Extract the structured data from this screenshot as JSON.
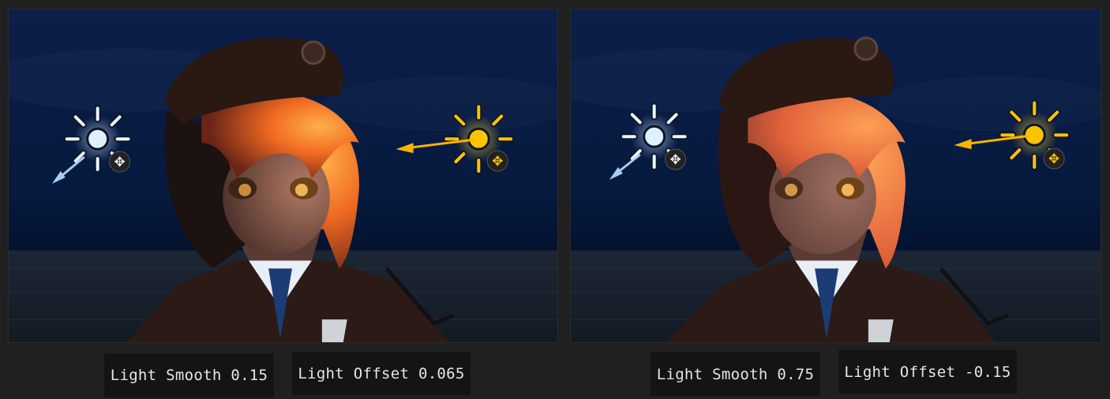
{
  "scenes": [
    {
      "light_smooth_text": "Light Smooth 0.15",
      "light_offset_text": "Light Offset 0.065",
      "light_smooth": 0.15,
      "light_offset": 0.065
    },
    {
      "light_smooth_text": "Light Smooth 0.75",
      "light_offset_text": "Light Offset -0.15",
      "light_smooth": 0.75,
      "light_offset": -0.15
    }
  ],
  "colors": {
    "background": "#202020",
    "caption_background": "#141414",
    "caption_text": "#e6e6e6",
    "sky": "#071a3e",
    "main_light": "#ffc400",
    "fill_light": "#dff0ff",
    "hair_lit": "#ff8a1a",
    "hair_shadow": "#7a2a1a"
  },
  "icons": {
    "key_light": "sun-directional-light-icon",
    "fill_light": "sun-directional-light-icon",
    "gizmo": "move-arrows-icon"
  }
}
